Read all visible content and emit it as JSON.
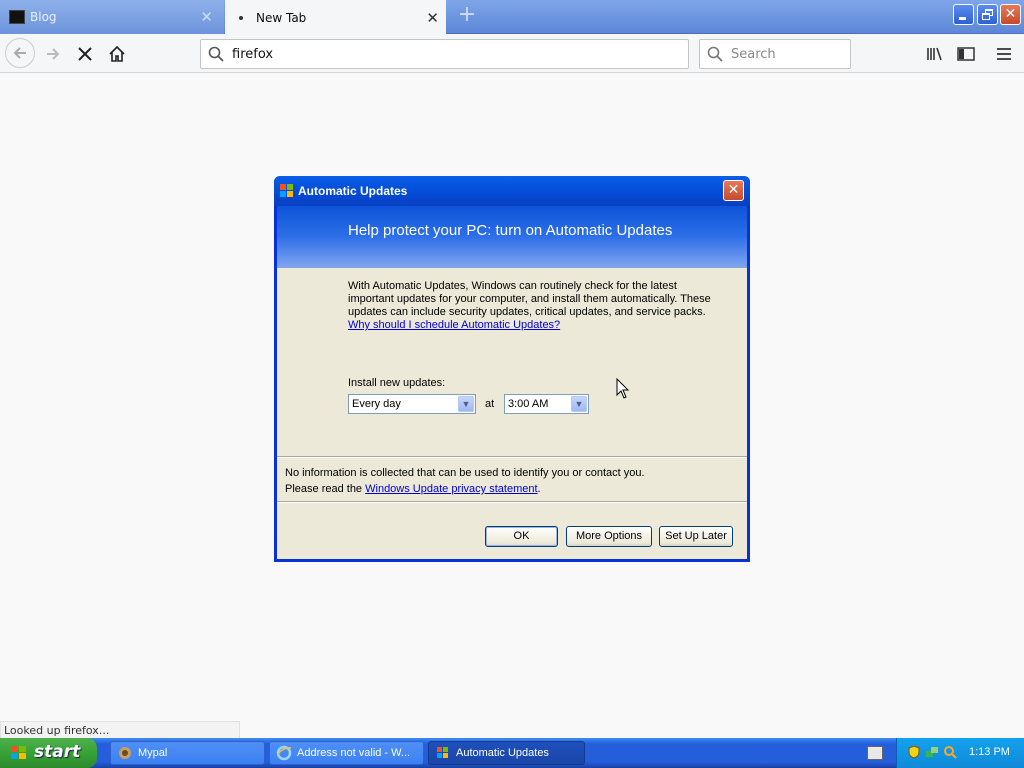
{
  "browser": {
    "tabs": [
      {
        "label": "Blog",
        "active": false
      },
      {
        "label": "New Tab",
        "active": true
      }
    ],
    "url": "firefox",
    "search_placeholder": "Search",
    "status": "Looked up firefox..."
  },
  "dialog": {
    "title": "Automatic Updates",
    "heading": "Help protect your PC: turn on Automatic Updates",
    "body_lines": [
      "With Automatic Updates, Windows can routinely check for the latest",
      "important updates for your computer, and install them automatically. These",
      "updates can include security updates, critical updates, and service packs."
    ],
    "why_link": "Why should I schedule Automatic Updates?",
    "install_label": "Install new updates:",
    "frequency": "Every day",
    "at_label": "at",
    "time": "3:00 AM",
    "privacy_line1": "No information is collected that can be used to identify you or contact you.",
    "privacy_line2_prefix": "Please read the ",
    "privacy_link": "Windows Update privacy statement",
    "privacy_line2_suffix": ".",
    "buttons": {
      "ok": "OK",
      "more": "More Options",
      "later": "Set Up Later"
    }
  },
  "taskbar": {
    "start": "start",
    "tasks": [
      {
        "label": "Mypal"
      },
      {
        "label": "Address not valid - W..."
      },
      {
        "label": "Automatic Updates",
        "active": true
      }
    ],
    "clock": "1:13 PM"
  },
  "colors": {
    "xp_blue": "#0831d9",
    "taskbar_blue": "#245edb",
    "start_green": "#37a236",
    "dialog_face": "#ece9d8",
    "link": "#0000cc"
  }
}
